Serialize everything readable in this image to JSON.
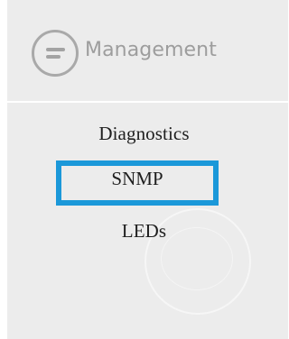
{
  "header": {
    "menu_icon": "hamburger-menu-icon",
    "title": "Management"
  },
  "nav": {
    "items": [
      {
        "label": "Diagnostics",
        "selected": false
      },
      {
        "label": "SNMP",
        "selected": true
      },
      {
        "label": "LEDs",
        "selected": false
      }
    ]
  },
  "colors": {
    "panel_background": "#ececec",
    "highlight_border": "#1b98d9",
    "header_text": "#9d9d9d",
    "item_text": "#1e1e1e",
    "icon_gray": "#a9a9a9"
  }
}
